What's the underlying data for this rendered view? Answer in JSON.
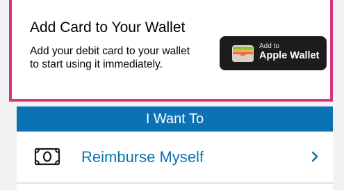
{
  "wallet_card": {
    "title": "Add Card to Your Wallet",
    "description": "Add your debit card to your wallet to start using it immediately.",
    "button_small": "Add to",
    "button_large": "Apple Wallet",
    "button_icon": "apple-wallet-icon",
    "highlight_color": "#d63384"
  },
  "actions": {
    "header": "I Want To",
    "header_color": "#0b72b5",
    "items": [
      {
        "label": "Reimburse Myself",
        "icon": "cash-icon",
        "trailing_icon": "chevron-right-icon"
      }
    ]
  }
}
